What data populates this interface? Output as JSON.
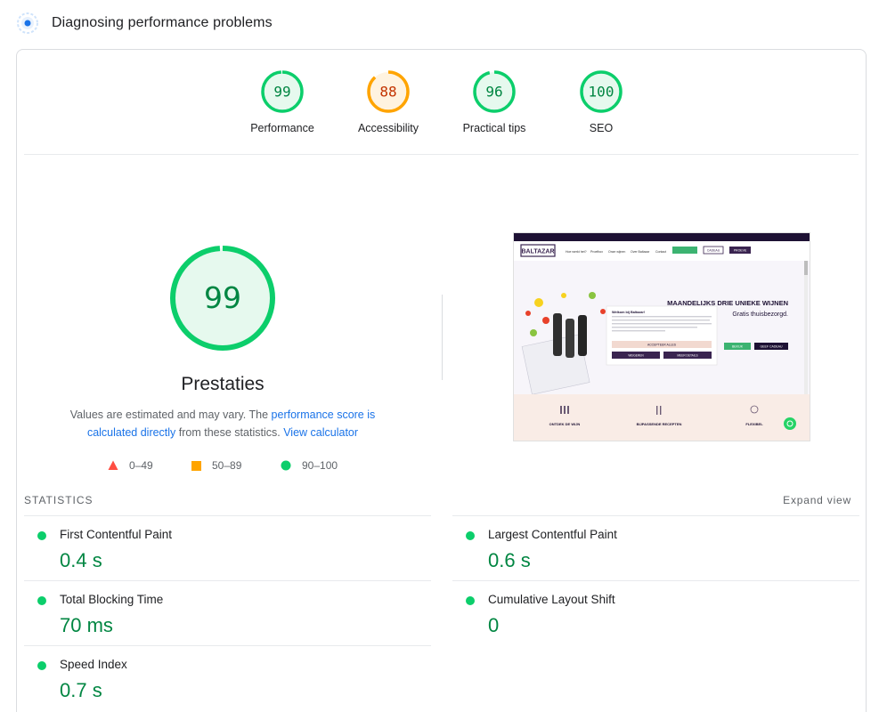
{
  "header": {
    "title": "Diagnosing performance problems",
    "icon": "lighthouse-icon"
  },
  "colors": {
    "pass": "#0cce6b",
    "pass_text": "#018642",
    "pass_fill": "#e6f9ee",
    "average": "#ffa400",
    "average_text": "#c33300",
    "average_fill": "#fff3e0",
    "fail": "#ff4e42"
  },
  "categories": [
    {
      "label": "Performance",
      "score": 99,
      "status": "pass"
    },
    {
      "label": "Accessibility",
      "score": 88,
      "status": "average"
    },
    {
      "label": "Practical tips",
      "score": 96,
      "status": "pass"
    },
    {
      "label": "SEO",
      "score": 100,
      "status": "pass"
    }
  ],
  "main": {
    "score": 99,
    "title": "Prestaties",
    "note_prefix": "Values are estimated and may vary. The ",
    "note_link1": "performance score is calculated directly",
    "note_middle": " from these statistics. ",
    "note_link2": "View calculator"
  },
  "legend": [
    {
      "range": "0–49",
      "shape": "triangle-icon"
    },
    {
      "range": "50–89",
      "shape": "square-icon"
    },
    {
      "range": "90–100",
      "shape": "circle-icon"
    }
  ],
  "preview": {
    "brand": "BALTAZAR",
    "nav": [
      "Hoe werkt het?",
      "Proefbox",
      "Onze wijnen",
      "Over Baltazar",
      "Contact"
    ],
    "nav_btn1": "",
    "nav_btn2": "CADEAU",
    "nav_btn3": "PROEVE",
    "hero_heading": "MAANDELIJKS DRIE UNIEKE WIJNEN",
    "hero_sub": "Gratis thuisbezorgd.",
    "hero_btn1": "BEKIJK",
    "hero_btn2": "GEEF CADEAU",
    "cookie_title": "Welkom bij Baltazar!",
    "cookie_btn_accept": "ACCEPTEER ALLES",
    "cookie_btn_a": "WEIGEREN",
    "cookie_btn_b": "MEER DETAILS",
    "features": [
      "ONTDEK DE WIJN",
      "BIJPASSENDE RECEPTEN",
      "FLEXIBEL"
    ]
  },
  "statistics": {
    "title": "STATISTICS",
    "expand_label": "Expand view",
    "metrics": [
      {
        "label": "First Contentful Paint",
        "value": "0.4 s"
      },
      {
        "label": "Largest Contentful Paint",
        "value": "0.6 s"
      },
      {
        "label": "Total Blocking Time",
        "value": "70 ms"
      },
      {
        "label": "Cumulative Layout Shift",
        "value": "0"
      },
      {
        "label": "Speed Index",
        "value": "0.7 s"
      }
    ]
  }
}
